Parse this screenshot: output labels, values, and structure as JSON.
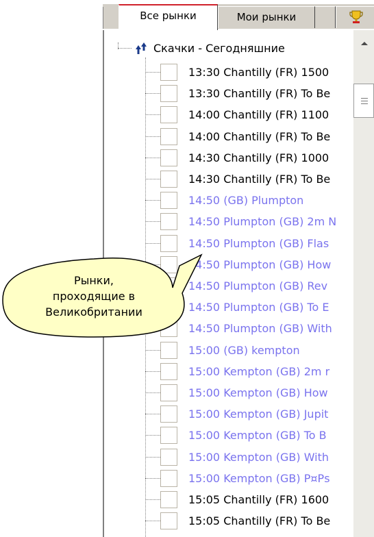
{
  "tabs": {
    "all_markets": "Все рынки",
    "my_markets": "Мои рынки"
  },
  "tree": {
    "root": {
      "label": "Скачки - Сегодняшние",
      "icon": "horse-racing-icon"
    },
    "items": [
      {
        "label": "13:30 Chantilly (FR) 1500",
        "region": "fr"
      },
      {
        "label": "13:30 Chantilly (FR) To Be",
        "region": "fr"
      },
      {
        "label": "14:00 Chantilly (FR) 1100",
        "region": "fr"
      },
      {
        "label": "14:00 Chantilly (FR) To Be",
        "region": "fr"
      },
      {
        "label": "14:30 Chantilly (FR) 1000",
        "region": "fr"
      },
      {
        "label": "14:30 Chantilly (FR) To Be",
        "region": "fr"
      },
      {
        "label": "14:50 (GB) Plumpton",
        "region": "uk"
      },
      {
        "label": "14:50 Plumpton (GB) 2m N",
        "region": "uk"
      },
      {
        "label": "14:50 Plumpton (GB) Flas",
        "region": "uk"
      },
      {
        "label": "14:50 Plumpton (GB) How",
        "region": "uk"
      },
      {
        "label": "14:50 Plumpton (GB) Rev",
        "region": "uk"
      },
      {
        "label": "14:50 Plumpton (GB) To E",
        "region": "uk"
      },
      {
        "label": "14:50 Plumpton (GB) With",
        "region": "uk"
      },
      {
        "label": "15:00 (GB) kempton",
        "region": "uk"
      },
      {
        "label": "15:00 Kempton (GB) 2m r",
        "region": "uk"
      },
      {
        "label": "15:00 Kempton (GB) How",
        "region": "uk"
      },
      {
        "label": "15:00 Kempton (GB) Jupit",
        "region": "uk"
      },
      {
        "label": "15:00 Kempton (GB) To B",
        "region": "uk"
      },
      {
        "label": "15:00 Kempton (GB) With",
        "region": "uk"
      },
      {
        "label": "15:00 Kempton (GB) Р¤Рѕ",
        "region": "uk"
      },
      {
        "label": "15:05 Chantilly (FR) 1600",
        "region": "fr"
      },
      {
        "label": "15:05 Chantilly (FR) To Be",
        "region": "fr"
      }
    ]
  },
  "callout": {
    "lines": [
      "Рынки,",
      "проходящие в",
      "Великобритании"
    ]
  },
  "colors": {
    "uk_market": "#7a73ee",
    "fr_market": "#000000",
    "active_tab_accent": "#d0202a",
    "callout_fill": "#ffffc6"
  }
}
